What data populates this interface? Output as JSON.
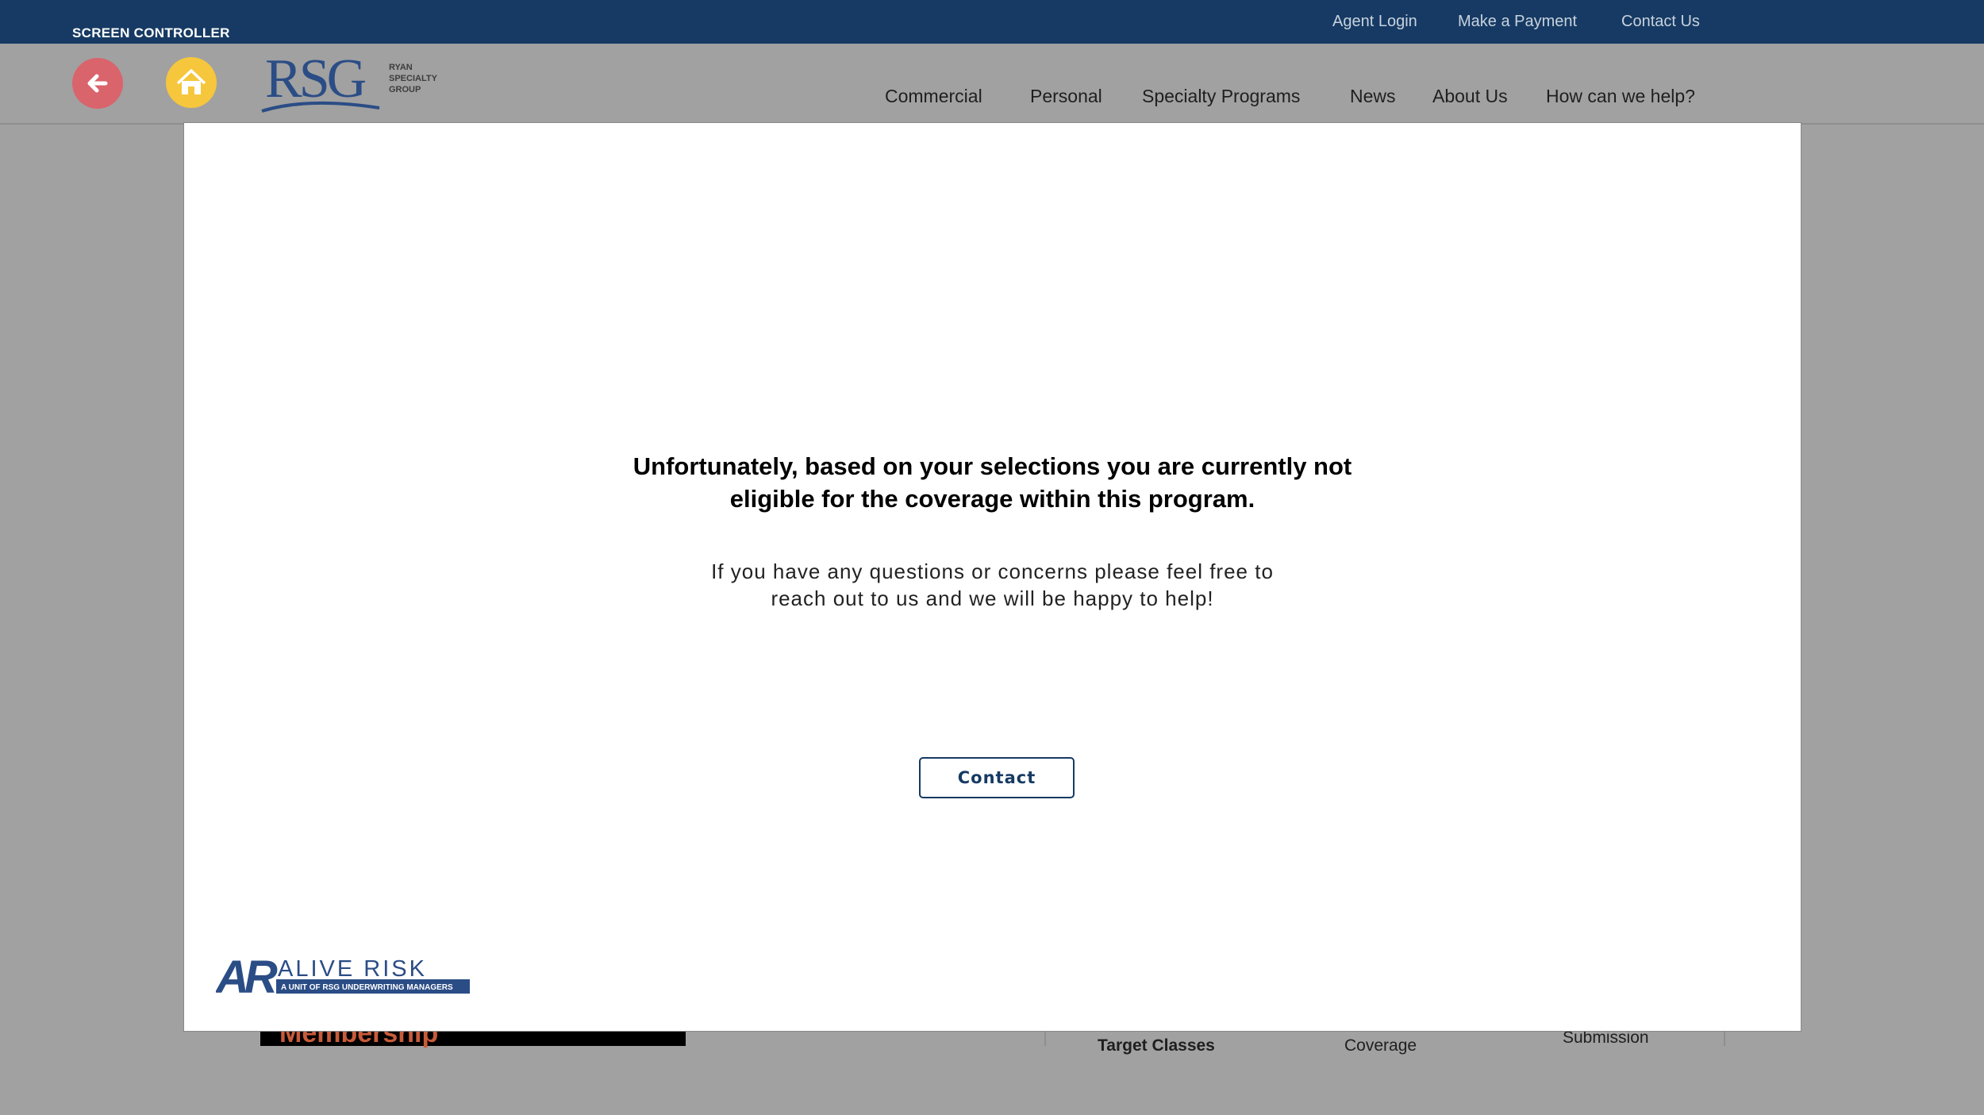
{
  "topbar": {
    "screen_controller": "SCREEN CONTROLLER",
    "links": [
      "Agent Login",
      "Make a Payment",
      "Contact Us"
    ]
  },
  "header": {
    "logo": {
      "mark": "RSG",
      "line1": "RYAN",
      "line2": "SPECIALTY",
      "line3": "GROUP"
    },
    "nav": [
      "Commercial",
      "Personal",
      "Specialty Programs",
      "News",
      "About Us",
      "How can we help?"
    ]
  },
  "background": {
    "membership": "Membership",
    "target_classes": "Target Classes",
    "coverage": "Coverage",
    "submission": "Submission"
  },
  "modal": {
    "headline_line1": "Unfortunately, based on your selections you are currently not",
    "headline_line2": "eligible for the coverage within this program.",
    "body_line1": "If you have any questions or concerns please feel free to",
    "body_line2": "reach out to us and we will be happy to help!",
    "contact_label": "Contact",
    "alive_logo": {
      "mark": "AR",
      "name": "ALIVE RISK",
      "tagline": "A UNIT OF RSG UNDERWRITING MANAGERS"
    }
  },
  "colors": {
    "topbar": "#163a63",
    "back_button": "#d9646c",
    "home_button": "#f6c73c",
    "rsg_blue": "#2b4d86"
  },
  "icons": [
    "arrow-left-icon",
    "home-icon"
  ]
}
